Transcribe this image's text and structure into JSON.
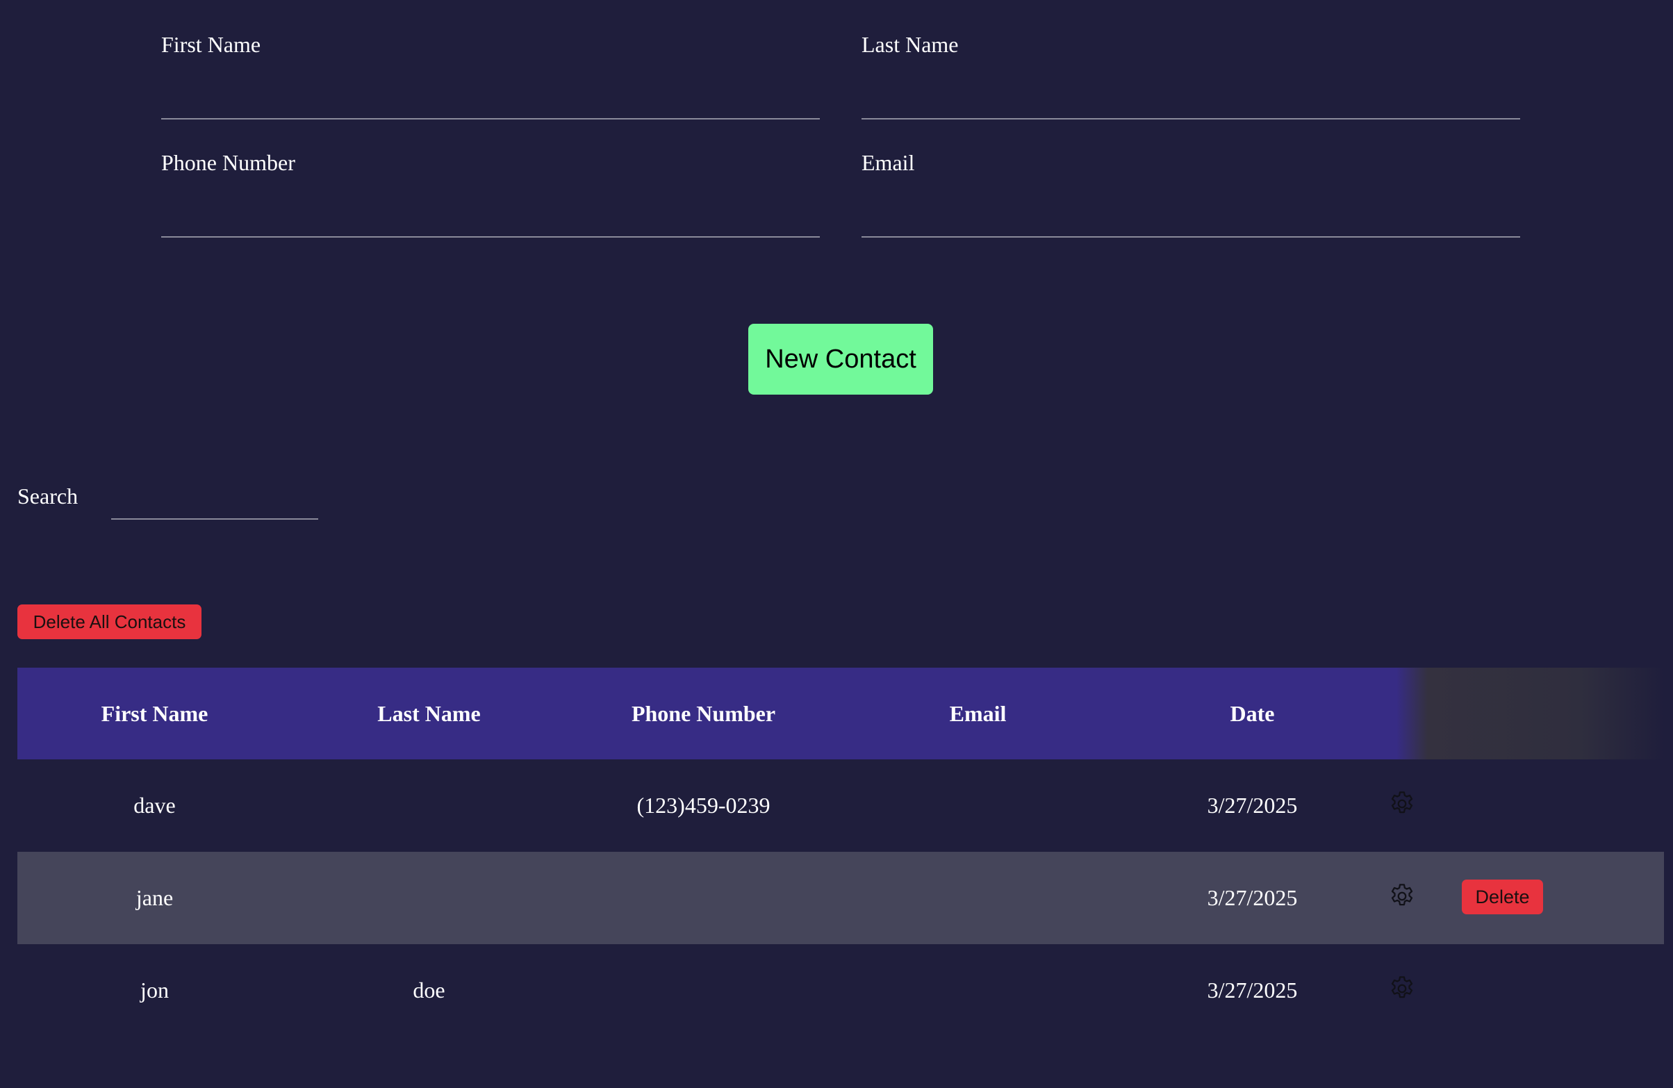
{
  "form": {
    "first_name_label": "First Name",
    "last_name_label": "Last Name",
    "phone_label": "Phone Number",
    "email_label": "Email",
    "first_name_value": "",
    "last_name_value": "",
    "phone_value": "",
    "email_value": "",
    "submit_label": "New Contact",
    "submit_color": "#72f99a"
  },
  "search": {
    "label": "Search",
    "value": ""
  },
  "delete_all_label": "Delete All Contacts",
  "danger_color": "#e8333e",
  "table": {
    "header_color": "#372c85",
    "columns": [
      "First Name",
      "Last Name",
      "Phone Number",
      "Email",
      "Date"
    ],
    "rows": [
      {
        "first": "dave",
        "last": "",
        "phone": "(123)459-0239",
        "email": "",
        "date": "3/27/2025",
        "action_icon": "gear-icon",
        "delete_label": ""
      },
      {
        "first": "jane",
        "last": "",
        "phone": "",
        "email": "",
        "date": "3/27/2025",
        "action_icon": "gear-icon",
        "delete_label": "Delete"
      },
      {
        "first": "jon",
        "last": "doe",
        "phone": "",
        "email": "",
        "date": "3/27/2025",
        "action_icon": "gear-icon",
        "delete_label": ""
      }
    ]
  }
}
